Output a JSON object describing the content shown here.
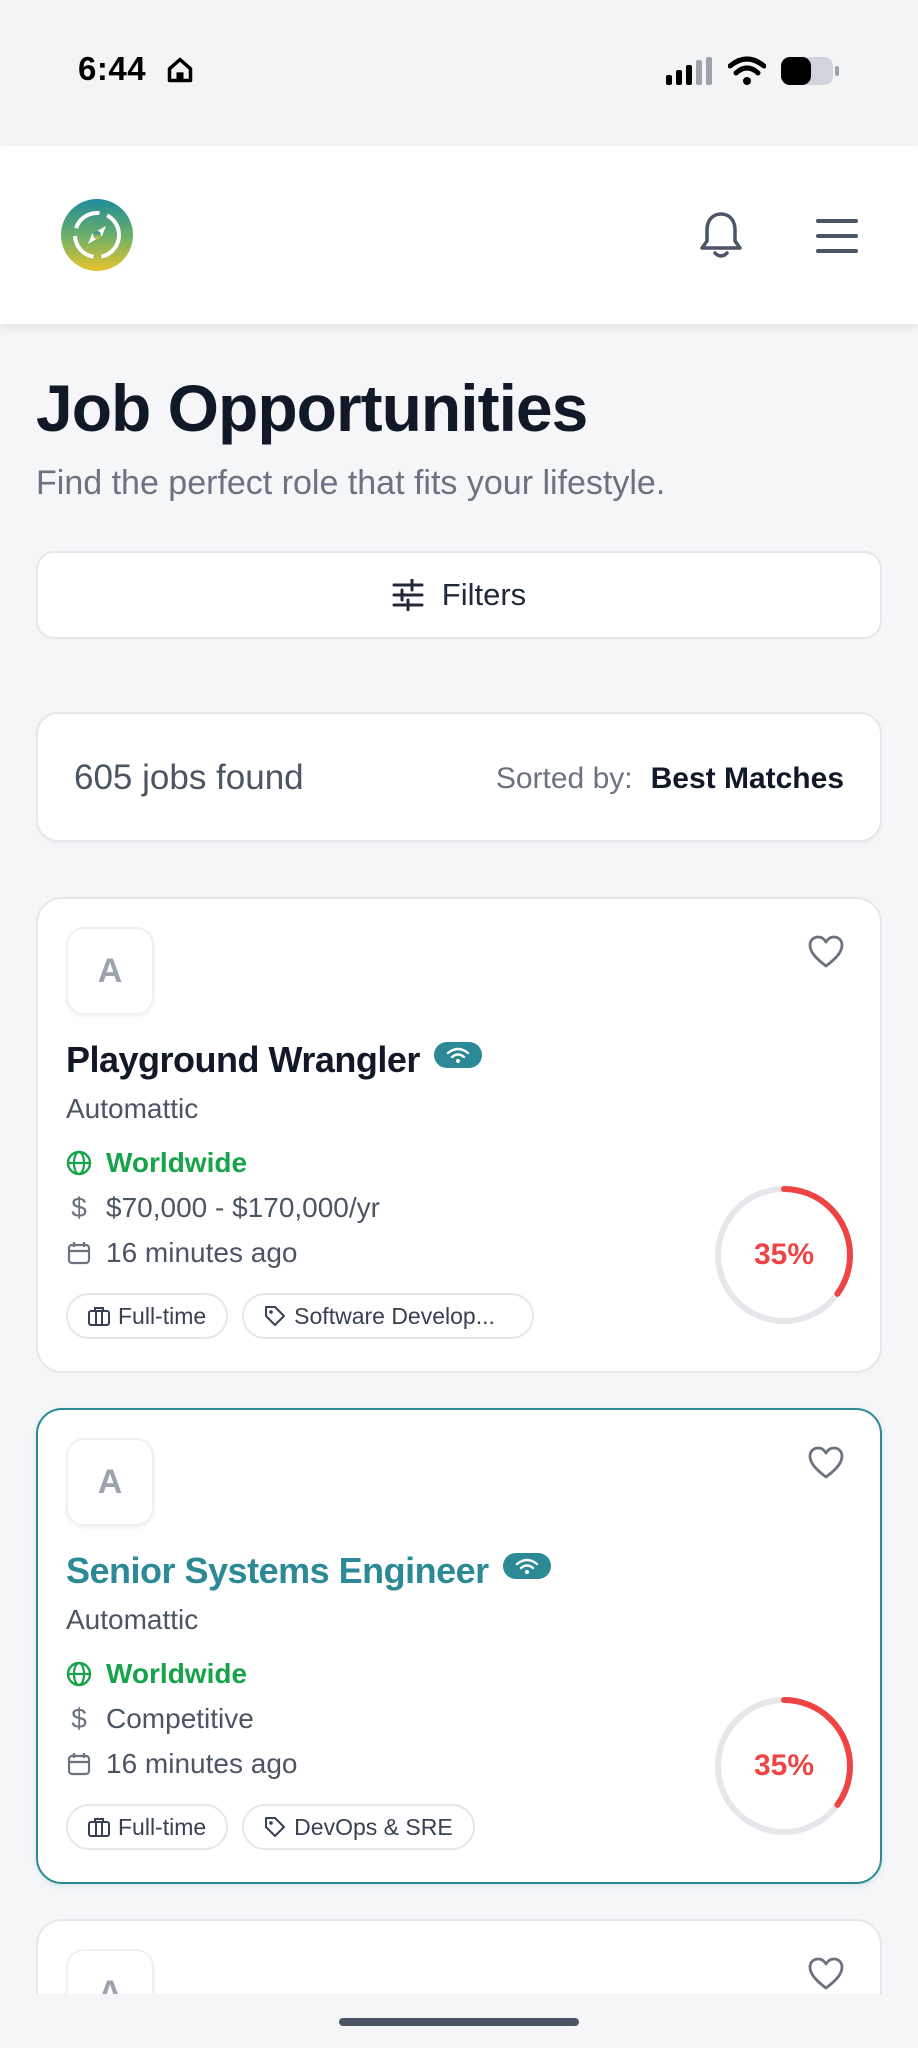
{
  "status_bar": {
    "time": "6:44",
    "icons": [
      "home-status-icon",
      "signal-icon",
      "wifi-icon",
      "battery-icon"
    ]
  },
  "header": {
    "logo": "app-logo",
    "icons": [
      "bell-icon",
      "hamburger-menu-icon"
    ]
  },
  "page": {
    "title": "Job Opportunities",
    "subtitle": "Find the perfect role that fits your lifestyle."
  },
  "filters": {
    "label": "Filters",
    "icon": "sliders-icon"
  },
  "results": {
    "count_text": "605 jobs found",
    "sort_label": "Sorted by:",
    "sort_value": "Best Matches"
  },
  "jobs": [
    {
      "logo_letter": "A",
      "title": "Playground Wrangler",
      "company": "Automattic",
      "location": "Worldwide",
      "salary": "$70,000 - $170,000/yr",
      "posted": "16 minutes ago",
      "tags": [
        "Full-time",
        "Software Develop..."
      ],
      "match": "35%",
      "match_fraction": 0.35,
      "selected": false
    },
    {
      "logo_letter": "A",
      "title": "Senior Systems Engineer",
      "company": "Automattic",
      "location": "Worldwide",
      "salary": "Competitive",
      "posted": "16 minutes ago",
      "tags": [
        "Full-time",
        "DevOps & SRE"
      ],
      "match": "35%",
      "match_fraction": 0.35,
      "selected": true
    },
    {
      "logo_letter": "A"
    }
  ],
  "colors": {
    "brand_teal": "#2b8a95",
    "location_green": "#16a34a",
    "match_red": "#ef4444"
  }
}
